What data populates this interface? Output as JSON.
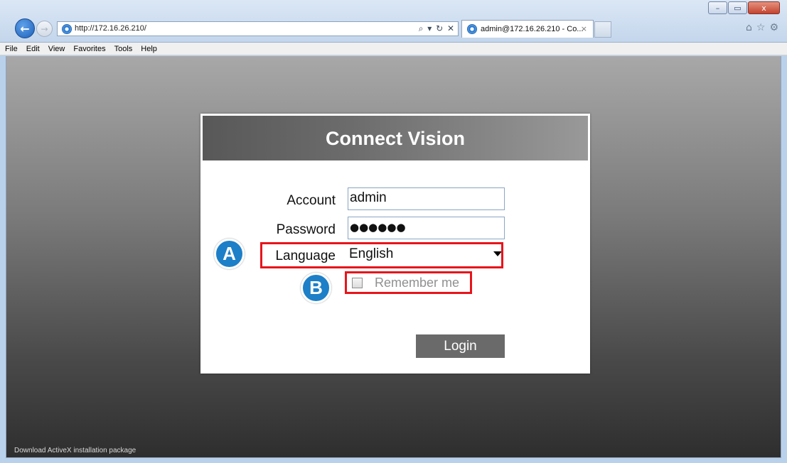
{
  "browser": {
    "url": "http://172.16.26.210/",
    "address_tools": "⌕ ▾ ↻ ✕",
    "tab_title": "admin@172.16.26.210 - Co...",
    "tab_close": "×",
    "right_icons": [
      "⌂",
      "☆",
      "⚙"
    ],
    "window_controls": [
      "–",
      "▭",
      "x"
    ],
    "back_icon": "←",
    "forward_icon": "→"
  },
  "menu": [
    "File",
    "Edit",
    "View",
    "Favorites",
    "Tools",
    "Help"
  ],
  "login": {
    "title": "Connect Vision",
    "account_label": "Account",
    "account_value": "admin",
    "password_label": "Password",
    "password_value": "●●●●●●",
    "language_label": "Language",
    "language_value": "English",
    "remember_label": "Remember me",
    "login_button": "Login"
  },
  "footer_link": "Download ActiveX installation package",
  "annotations": {
    "badge_a": "A",
    "badge_b": "B",
    "highlight_color": "#e8141b",
    "badge_color": "#1d7fc7"
  }
}
